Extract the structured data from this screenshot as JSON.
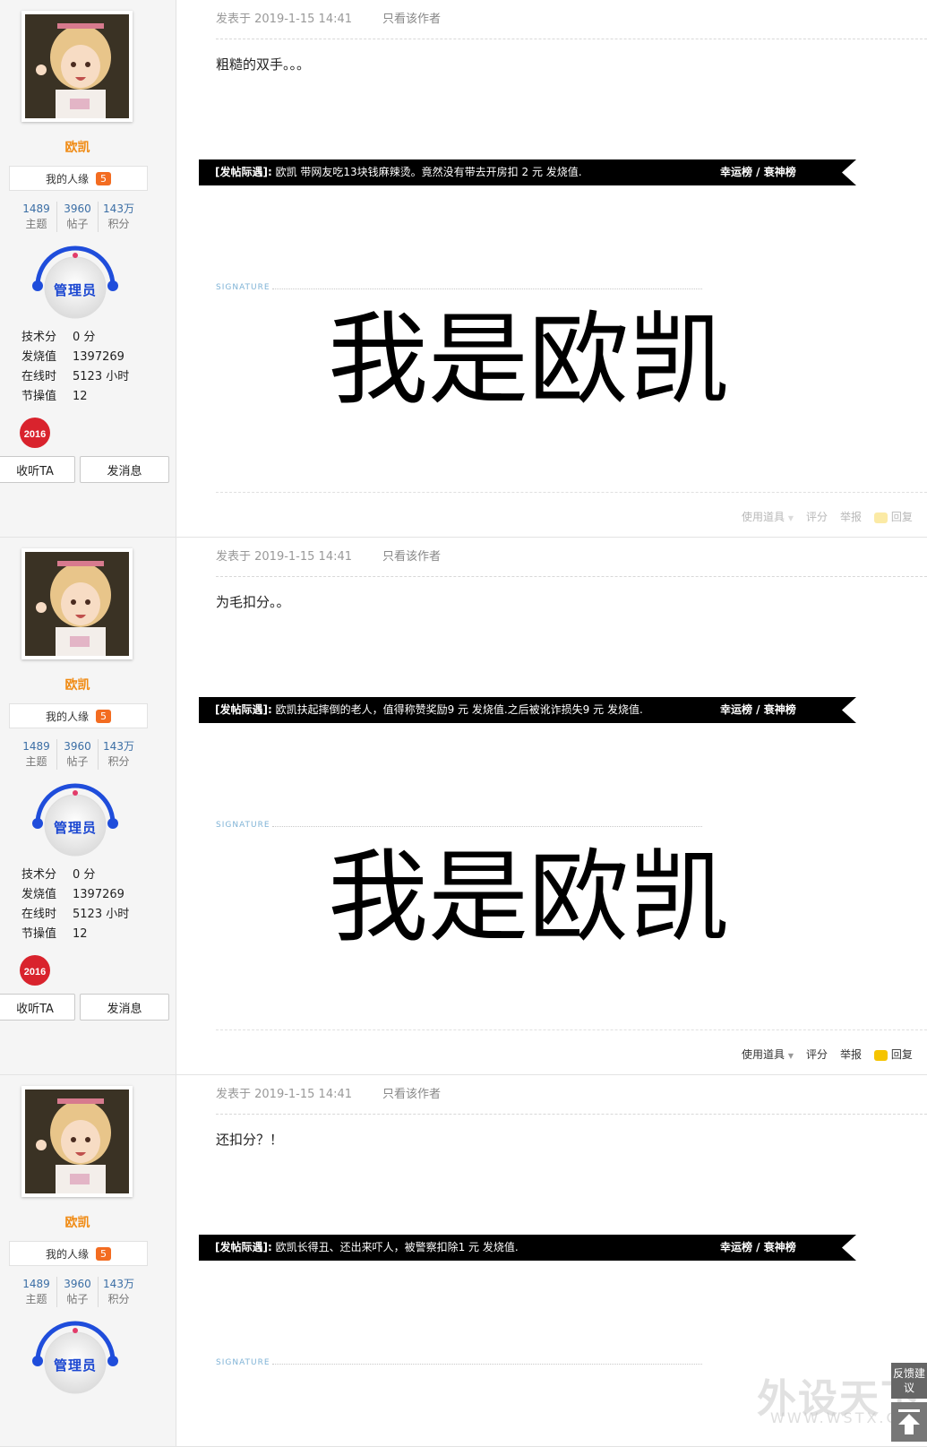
{
  "posts": [
    {
      "user": {
        "name": "欧凯",
        "relation_label": "我的人缘",
        "relation_count": "5",
        "stats": [
          {
            "num": "1489",
            "label": "主题"
          },
          {
            "num": "3960",
            "label": "帖子"
          },
          {
            "num": "143万",
            "label": "积分"
          }
        ],
        "role": "管理员",
        "info": [
          {
            "k": "技术分",
            "v": "0 分"
          },
          {
            "k": "发烧值",
            "v": "1397269"
          },
          {
            "k": "在线时",
            "v": "5123 小时"
          },
          {
            "k": "节操值",
            "v": "12"
          }
        ],
        "badge_text": "2016",
        "listen_label": "收听TA",
        "message_label": "发消息"
      },
      "posted": "发表于 2019-1-15 14:41",
      "author_only": "只看该作者",
      "content": "粗糙的双手。。。",
      "banner": {
        "prefix": "[发帖际遇]:",
        "text": " 欧凯 带网友吃13块钱麻辣烫。竟然没有带去开房扣 2 元 发烧值.",
        "rank": "幸运榜 / 衰神榜"
      },
      "signature_label": "SIGNATURE",
      "signature_text": "我是欧凯",
      "actions": {
        "tools": "使用道具",
        "rate": "评分",
        "report": "举报",
        "reply": "回复"
      }
    },
    {
      "user": {
        "name": "欧凯",
        "relation_label": "我的人缘",
        "relation_count": "5",
        "stats": [
          {
            "num": "1489",
            "label": "主题"
          },
          {
            "num": "3960",
            "label": "帖子"
          },
          {
            "num": "143万",
            "label": "积分"
          }
        ],
        "role": "管理员",
        "info": [
          {
            "k": "技术分",
            "v": "0 分"
          },
          {
            "k": "发烧值",
            "v": "1397269"
          },
          {
            "k": "在线时",
            "v": "5123 小时"
          },
          {
            "k": "节操值",
            "v": "12"
          }
        ],
        "badge_text": "2016",
        "listen_label": "收听TA",
        "message_label": "发消息"
      },
      "posted": "发表于 2019-1-15 14:41",
      "author_only": "只看该作者",
      "content": "为毛扣分。。",
      "banner": {
        "prefix": "[发帖际遇]:",
        "text": " 欧凯扶起摔倒的老人，值得称赞奖励9 元 发烧值.之后被讹诈损失9 元 发烧值.",
        "rank": "幸运榜 / 衰神榜"
      },
      "signature_label": "SIGNATURE",
      "signature_text": "我是欧凯",
      "actions": {
        "tools": "使用道具",
        "rate": "评分",
        "report": "举报",
        "reply": "回复"
      }
    },
    {
      "user": {
        "name": "欧凯",
        "relation_label": "我的人缘",
        "relation_count": "5",
        "stats": [
          {
            "num": "1489",
            "label": "主题"
          },
          {
            "num": "3960",
            "label": "帖子"
          },
          {
            "num": "143万",
            "label": "积分"
          }
        ],
        "role": "管理员"
      },
      "posted": "发表于 2019-1-15 14:41",
      "author_only": "只看该作者",
      "content": "还扣分？！",
      "banner": {
        "prefix": "[发帖际遇]:",
        "text": " 欧凯长得丑、还出来吓人，被警察扣除1 元 发烧值.",
        "rank": "幸运榜 / 衰神榜"
      },
      "signature_label": "SIGNATURE"
    }
  ],
  "widget": {
    "feedback": "反馈建议"
  },
  "watermark": {
    "main": "外设天下",
    "url": "WWW.WSTX.COM"
  }
}
